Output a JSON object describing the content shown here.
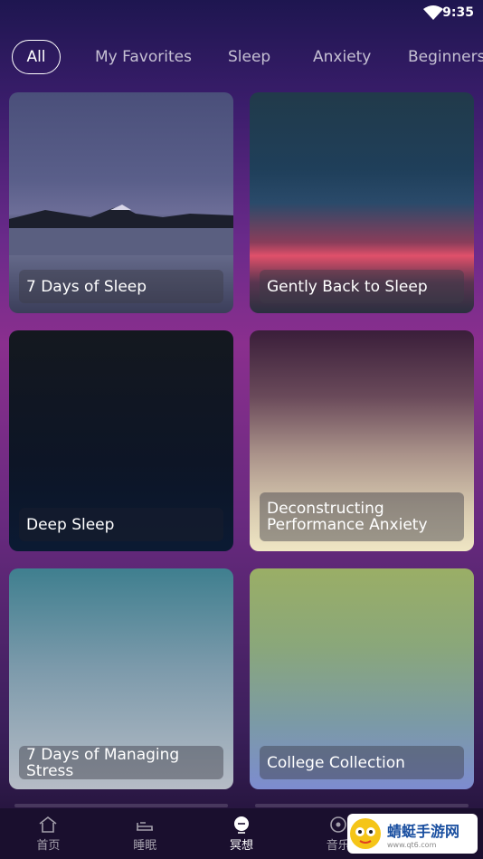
{
  "status_bar": {
    "time": "9:35"
  },
  "tabs": [
    "All",
    "My Favorites",
    "Sleep",
    "Anxiety",
    "Beginners"
  ],
  "cards": [
    {
      "title": "7 Days of Sleep"
    },
    {
      "title": "Gently Back to Sleep"
    },
    {
      "title": "Deep Sleep"
    },
    {
      "title": "Deconstructing Performance Anxiety"
    },
    {
      "title": "7 Days of Managing Stress"
    },
    {
      "title": "College Collection"
    }
  ],
  "bottom_nav": [
    "首页",
    "睡眠",
    "冥想",
    "音乐",
    ""
  ],
  "watermark": {
    "title": "蜻蜓手游网",
    "sub": "www.qt6.com"
  }
}
